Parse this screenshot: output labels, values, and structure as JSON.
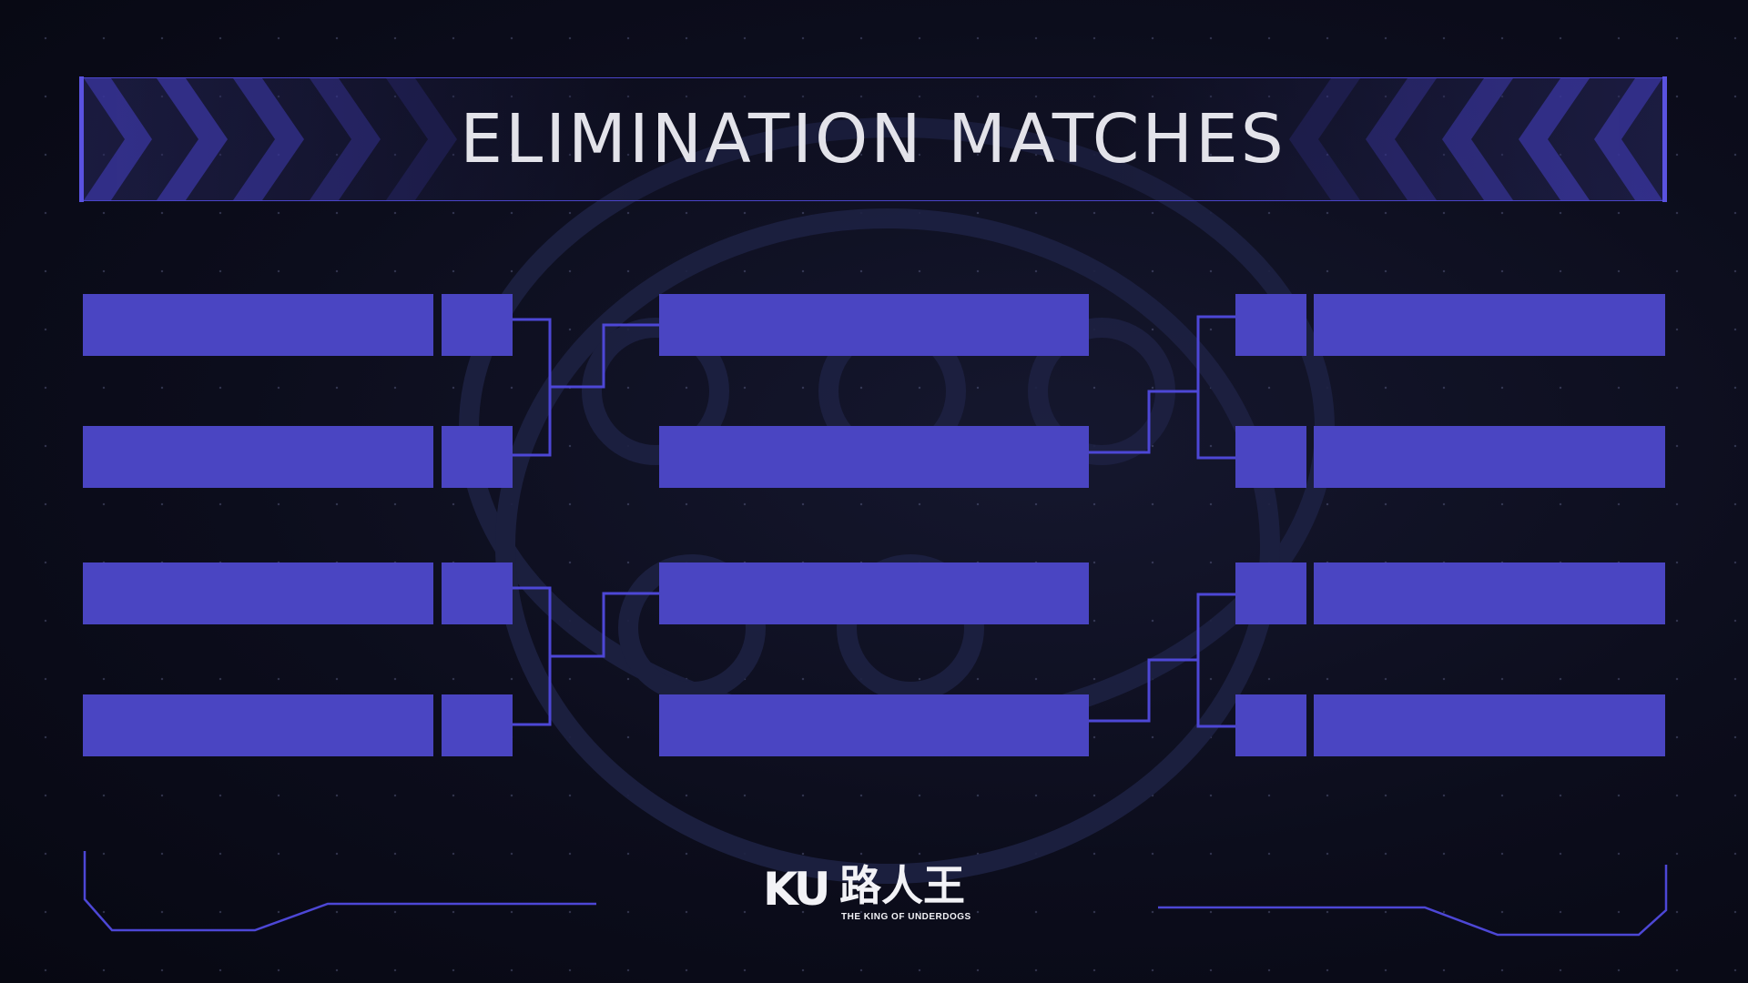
{
  "header": {
    "title": "ELIMINATION MATCHES"
  },
  "logo": {
    "mark": "KU",
    "chinese_name": "路人王",
    "tagline": "THE KING OF UNDERDOGS"
  },
  "colors": {
    "background": "#0c0d1c",
    "accent": "#4a45c2",
    "line": "#4d47d6",
    "title_text": "#e3e3ea"
  },
  "bracket": {
    "round_1": [
      {
        "team": "",
        "score": ""
      },
      {
        "team": "",
        "score": ""
      },
      {
        "team": "",
        "score": ""
      },
      {
        "team": "",
        "score": ""
      }
    ],
    "round_2": [
      {
        "team": ""
      },
      {
        "team": ""
      },
      {
        "team": ""
      },
      {
        "team": ""
      }
    ],
    "round_3": [
      {
        "team": "",
        "score": ""
      },
      {
        "team": "",
        "score": ""
      },
      {
        "team": "",
        "score": ""
      },
      {
        "team": "",
        "score": ""
      }
    ]
  }
}
